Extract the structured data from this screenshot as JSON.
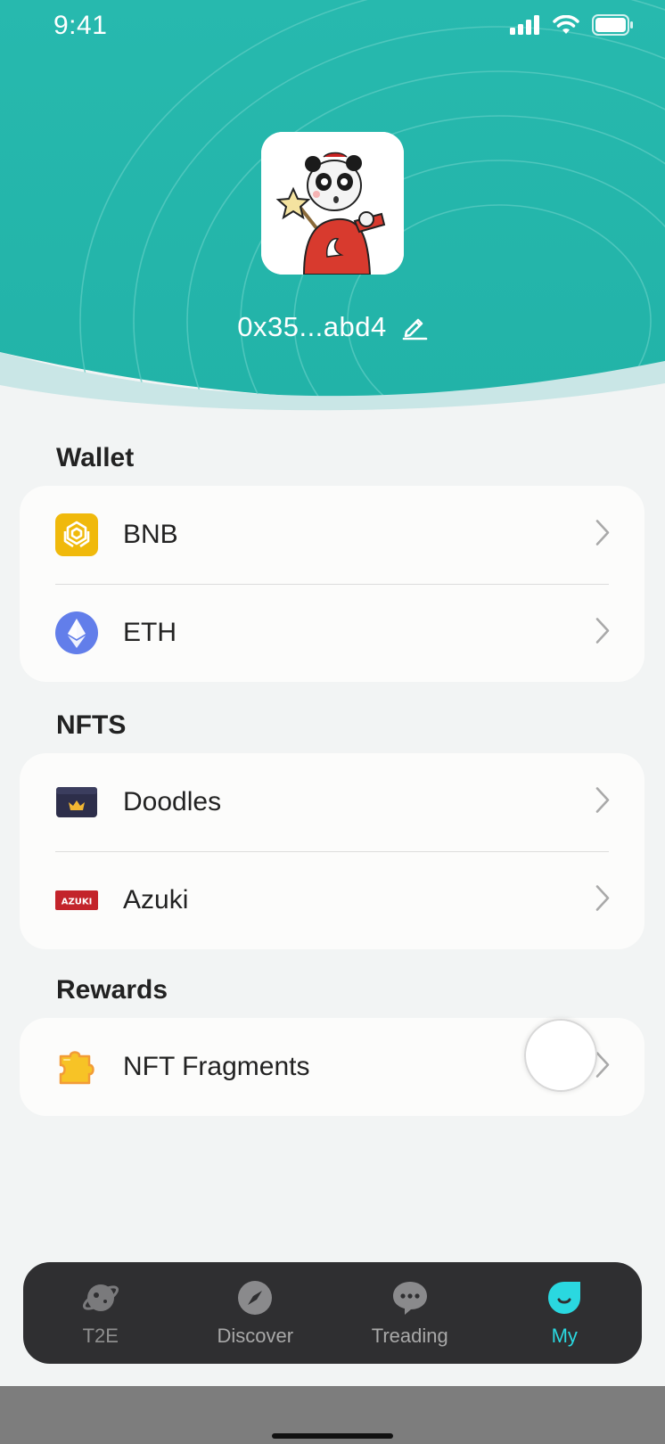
{
  "status": {
    "time": "9:41"
  },
  "profile": {
    "address": "0x35...abd4"
  },
  "sections": {
    "wallet": {
      "title": "Wallet",
      "items": [
        {
          "label": "BNB",
          "icon": "bnb-icon"
        },
        {
          "label": "ETH",
          "icon": "eth-icon"
        }
      ]
    },
    "nfts": {
      "title": "NFTS",
      "items": [
        {
          "label": "Doodles",
          "icon": "doodles-icon"
        },
        {
          "label": "Azuki",
          "icon": "azuki-icon",
          "icon_text": "AZUKI"
        }
      ]
    },
    "rewards": {
      "title": "Rewards",
      "items": [
        {
          "label": "NFT Fragments",
          "icon": "puzzle-icon"
        }
      ]
    }
  },
  "tabbar": {
    "tabs": [
      {
        "label": "T2E",
        "icon": "planet-icon"
      },
      {
        "label": "Discover",
        "icon": "compass-icon"
      },
      {
        "label": "Treading",
        "icon": "chat-bubble-icon"
      },
      {
        "label": "My",
        "icon": "drop-smile-icon",
        "active": true
      }
    ]
  },
  "colors": {
    "header_teal": "#25b8ad",
    "accent_cyan": "#2ad8e0",
    "tabbar_bg": "#2f2f31",
    "bnb_yellow": "#f0b90b",
    "eth_blue": "#627eea",
    "azuki_red": "#c3242b"
  }
}
